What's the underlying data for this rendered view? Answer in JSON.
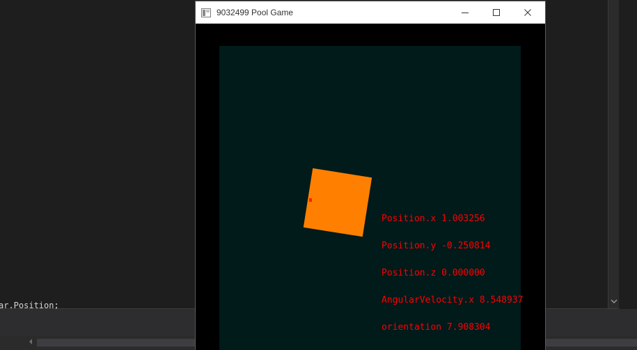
{
  "ide": {
    "code_fragment": "ar.Position;",
    "vscroll_arrow_icon": "chevron-down-icon",
    "hscroll_left_icon": "caret-left-icon"
  },
  "window": {
    "title": "9032499 Pool Game",
    "icon": "app-window-icon",
    "controls": {
      "minimize_icon": "minimize-icon",
      "maximize_icon": "maximize-icon",
      "close_icon": "close-icon"
    }
  },
  "scene": {
    "background_color": "#011a1a",
    "cube_color": "#ff8000",
    "contact_point_color": "#ff1a1a",
    "debug_lines": [
      "Position.x 1.003256",
      "Position.y -0.250814",
      "Position.z 0.000000",
      "AngularVelocity.x 8.548937",
      "orientation 7.908304"
    ],
    "debug_text_color": "#ff0000"
  }
}
